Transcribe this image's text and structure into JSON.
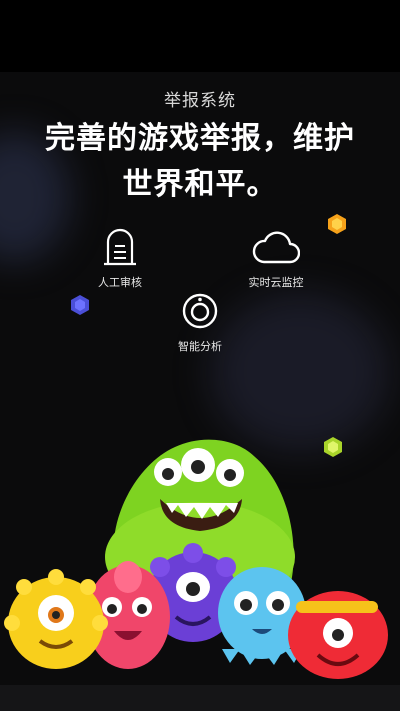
{
  "header": {
    "subtitle": "举报系统",
    "headline_line1": "完善的游戏举报，维护",
    "headline_line2": "世界和平。"
  },
  "features": [
    {
      "label": "人工审核",
      "icon": "tombstone-icon"
    },
    {
      "label": "实时云监控",
      "icon": "cloud-icon"
    },
    {
      "label": "智能分析",
      "icon": "speaker-icon"
    }
  ],
  "colors": {
    "background": "#0b0b0c",
    "gem_orange": "#f6a21a",
    "gem_blue": "#4b4fd8",
    "gem_lime": "#c6e83a"
  }
}
